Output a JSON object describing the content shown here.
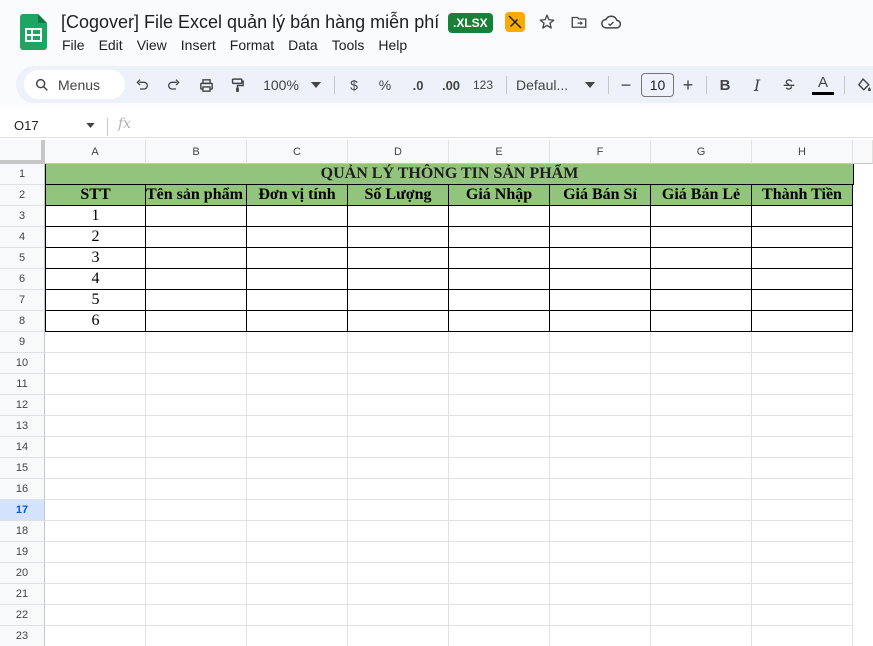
{
  "header": {
    "doc_title": "[Cogover] File Excel quản lý bán hàng miễn phí",
    "file_badge": ".XLSX"
  },
  "menu": [
    "File",
    "Edit",
    "View",
    "Insert",
    "Format",
    "Data",
    "Tools",
    "Help"
  ],
  "toolbar": {
    "search_label": "Menus",
    "zoom": "100%",
    "currency": "$",
    "percent": "%",
    "decrease_decimal": ".0",
    "increase_decimal": ".00",
    "number_format": "123",
    "font_family": "Defaul...",
    "font_size": "10",
    "minus": "−",
    "plus": "+",
    "bold": "B",
    "italic": "I",
    "text_color": "A"
  },
  "formula_bar": {
    "cell_ref": "O17",
    "fx": "fx"
  },
  "grid": {
    "columns": [
      "A",
      "B",
      "C",
      "D",
      "E",
      "F",
      "G",
      "H"
    ],
    "rows": [
      "1",
      "2",
      "3",
      "4",
      "5",
      "6",
      "7",
      "8",
      "9",
      "10",
      "11",
      "12",
      "13",
      "14",
      "15",
      "16",
      "17",
      "18",
      "19",
      "20",
      "21",
      "22",
      "23"
    ],
    "selected_row": "17",
    "title": "QUẢN LÝ THÔNG TIN SẢN PHẨM",
    "headers": [
      "STT",
      "Tên sản phẩm",
      "Đơn vị tính",
      "Số Lượng",
      "Giá Nhập",
      "Giá Bán Sỉ",
      "Giá Bán Lẻ",
      "Thành Tiền"
    ],
    "stt": [
      "1",
      "2",
      "3",
      "4",
      "5",
      "6"
    ],
    "header_color": "#93c47d"
  }
}
